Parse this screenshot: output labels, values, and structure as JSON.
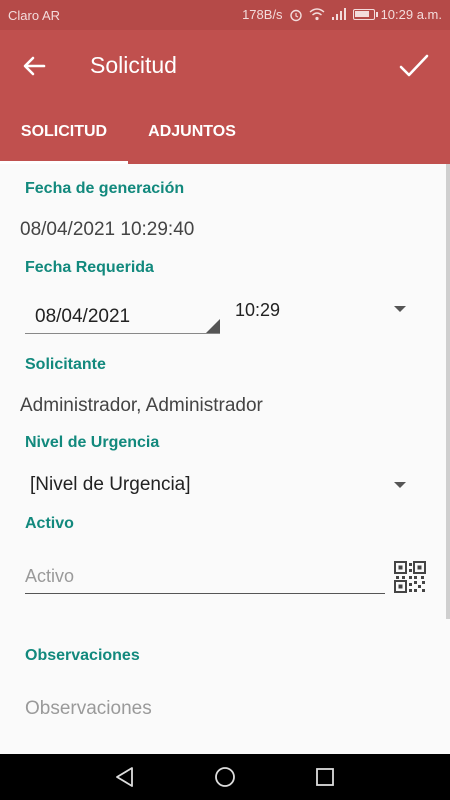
{
  "status_bar": {
    "carrier": "Claro AR",
    "data_rate": "178B/s",
    "time": "10:29 a.m."
  },
  "toolbar": {
    "title": "Solicitud",
    "back_icon": "arrow-back-icon",
    "confirm_icon": "check-icon"
  },
  "tabs": [
    {
      "label": "SOLICITUD",
      "active": true
    },
    {
      "label": "ADJUNTOS",
      "active": false
    }
  ],
  "form": {
    "fecha_generacion": {
      "label": "Fecha de generación",
      "value": "08/04/2021 10:29:40"
    },
    "fecha_requerida": {
      "label": "Fecha Requerida",
      "date": "08/04/2021",
      "time": "10:29"
    },
    "solicitante": {
      "label": "Solicitante",
      "value": "Administrador, Administrador"
    },
    "nivel_urgencia": {
      "label": "Nivel de Urgencia",
      "selected": "[Nivel de Urgencia]"
    },
    "activo": {
      "label": "Activo",
      "placeholder": "Activo",
      "scan_icon": "qr-code-icon"
    },
    "observaciones": {
      "label": "Observaciones",
      "placeholder": "Observaciones"
    }
  },
  "colors": {
    "primary": "#c0504e",
    "status_bar": "#b54a48",
    "accent": "#12897d"
  }
}
